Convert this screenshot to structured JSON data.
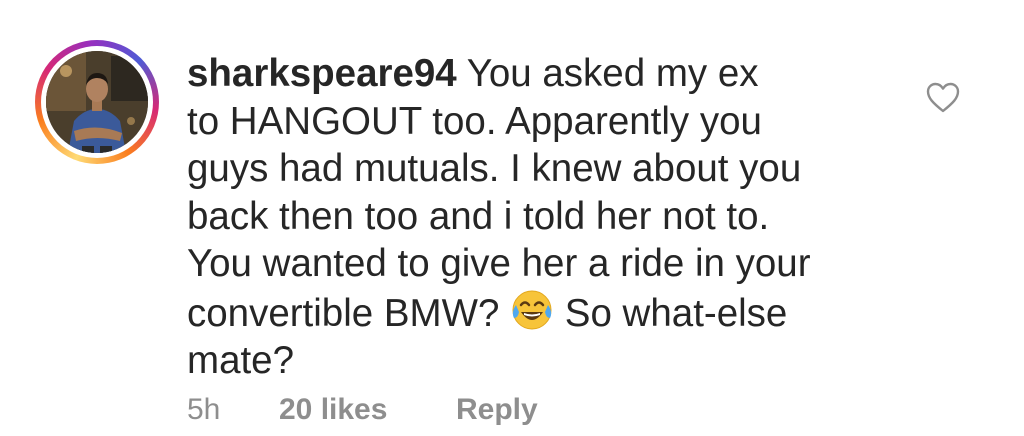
{
  "comment": {
    "username": "sharkspeare94",
    "text_before_emoji": " You asked my ex\nto HANGOUT too. Apparently you\nguys had mutuals. I knew about you\nback then too and i told her not to.\nYou wanted to give her a ride in your\nconvertible BMW? ",
    "emoji": "face-with-tears-of-joy",
    "text_after_emoji": " So what-else\nmate?",
    "time": "5h",
    "likes": "20 likes",
    "reply_label": "Reply",
    "icons": {
      "like": "heart-outline-icon",
      "avatar": "profile-photo"
    },
    "colors": {
      "text": "#262626",
      "meta": "#8e8e8e",
      "heart": "#8e8e8e"
    }
  }
}
